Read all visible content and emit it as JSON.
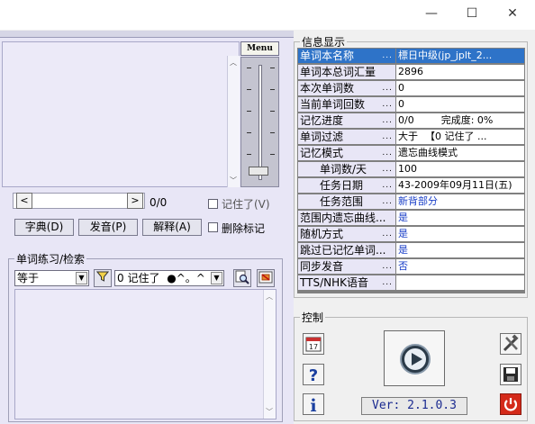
{
  "window": {
    "minimize_glyph": "—",
    "maximize_glyph": "☐",
    "close_glyph": "✕"
  },
  "left": {
    "menu_label": "Menu",
    "pager": {
      "prev": "<",
      "next": ">",
      "position": "0/0"
    },
    "remembered_label": "记住了(V)",
    "buttons": {
      "dictionary": "字典(D)",
      "pronounce": "发音(P)",
      "explain": "解释(A)"
    },
    "delete_mark_label": "删除标记"
  },
  "search": {
    "title": "单词练习/检索",
    "operator": "等于",
    "filter_icon": "funnel-icon",
    "condition": "0 记住了",
    "symbol": "●^。^",
    "search_icon": "magnify-icon",
    "clear_icon": "clear-icon"
  },
  "info": {
    "title": "信息显示",
    "rows": [
      {
        "label": "单词本名称",
        "dots": "...",
        "value": "標日中级(jp_jplt_2...",
        "selected": true
      },
      {
        "label": "单词本总词汇量",
        "dots": "",
        "value": "2896"
      },
      {
        "label": "本次单词数",
        "dots": "...",
        "value": "0"
      },
      {
        "label": "当前单词回数",
        "dots": "...",
        "value": "0"
      },
      {
        "label": "记忆进度",
        "dots": "...",
        "value": "0/0",
        "extra": "完成度: 0%"
      },
      {
        "label": "单词过滤",
        "dots": "...",
        "value": "大于",
        "extra": "【0 记住了 ..."
      },
      {
        "label": "记忆模式",
        "dots": "...",
        "value": "遗忘曲线模式"
      },
      {
        "label": "单词数/天",
        "dots": "...",
        "value": "100",
        "indent": true
      },
      {
        "label": "任务日期",
        "dots": "...",
        "value": "43-2009年09月11日(五)",
        "indent": true
      },
      {
        "label": "任务范围",
        "dots": "...",
        "value": "新背部分",
        "indent": true,
        "blue": true
      },
      {
        "label": "范围内遗忘曲线...",
        "dots": "",
        "value": "是",
        "blue": true
      },
      {
        "label": "随机方式",
        "dots": "...",
        "value": "是",
        "blue": true
      },
      {
        "label": "跳过已记忆单词...",
        "dots": "",
        "value": "是",
        "blue": true
      },
      {
        "label": "同步发音",
        "dots": "...",
        "value": "否",
        "blue": true
      },
      {
        "label": "TTS/NHK语音",
        "dots": "...",
        "value": ""
      }
    ]
  },
  "control": {
    "title": "控制",
    "calendar_icon": "calendar-icon",
    "help_icon": "help-icon",
    "info_icon": "info-icon",
    "play_icon": "play-icon",
    "tools_icon": "tools-icon",
    "save_icon": "save-icon",
    "power_icon": "power-icon",
    "version": "Ver: 2.1.0.3"
  },
  "colors": {
    "selection": "#2e73c8",
    "value_blue": "#1a3fc8",
    "panel_lavender": "#e8e6f6"
  }
}
